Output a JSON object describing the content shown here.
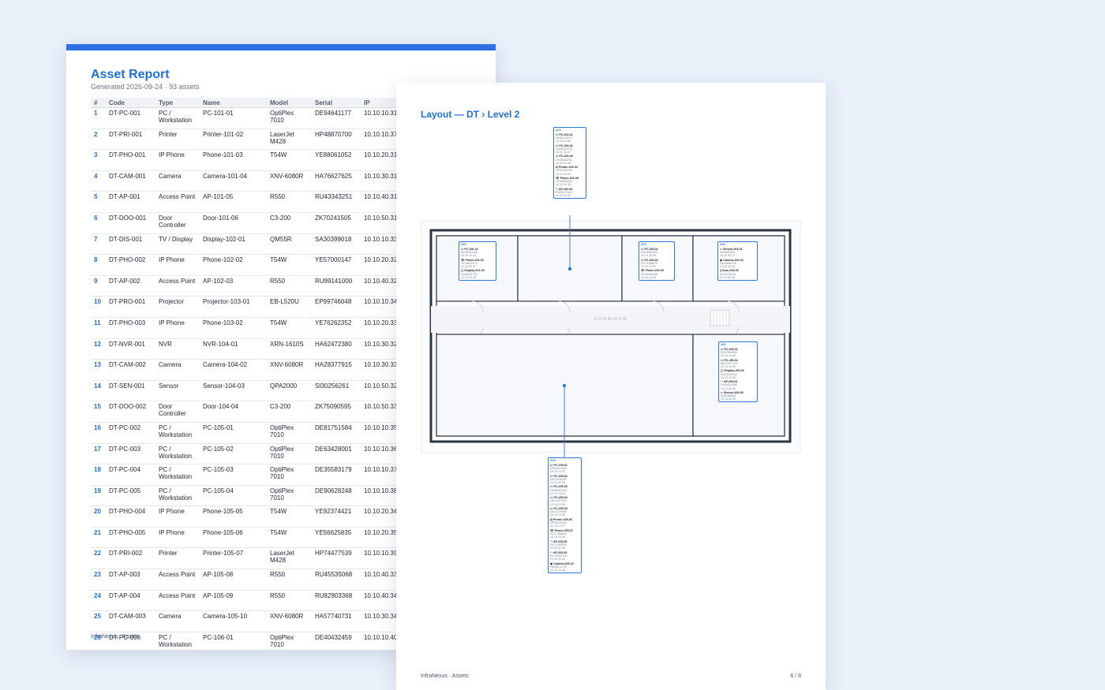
{
  "report": {
    "title": "Asset Report",
    "subtitle": "Generated 2026-09-24 · 93 assets",
    "columns": [
      "#",
      "Code",
      "Type",
      "Name",
      "Model",
      "Serial",
      "IP"
    ],
    "rows": [
      [
        "1",
        "DT-PC-001",
        "PC / Workstation",
        "PC-101-01",
        "OptiPlex 7010",
        "DE94641177",
        "10.10.10.31"
      ],
      [
        "2",
        "DT-PRI-001",
        "Printer",
        "Printer-101-02",
        "LaserJet M428",
        "HP48870700",
        "10.10.10.37"
      ],
      [
        "3",
        "DT-PHO-001",
        "IP Phone",
        "Phone-101-03",
        "T54W",
        "YE88061052",
        "10.10.20.31"
      ],
      [
        "4",
        "DT-CAM-001",
        "Camera",
        "Camera-101-04",
        "XNV-6080R",
        "HA76627625",
        "10.10.30.31"
      ],
      [
        "5",
        "DT-AP-001",
        "Access Point",
        "AP-101-05",
        "R550",
        "RU43343251",
        "10.10.40.31"
      ],
      [
        "6",
        "DT-DOO-001",
        "Door Controller",
        "Door-101-06",
        "C3-200",
        "ZK70241505",
        "10.10.50.31"
      ],
      [
        "7",
        "DT-DIS-001",
        "TV / Display",
        "Display-102-01",
        "QM55R",
        "SA30399018",
        "10.10.10.33"
      ],
      [
        "8",
        "DT-PHO-002",
        "IP Phone",
        "Phone-102-02",
        "T54W",
        "YE57000147",
        "10.10.20.32"
      ],
      [
        "9",
        "DT-AP-002",
        "Access Point",
        "AP-102-03",
        "R550",
        "RU99141000",
        "10.10.40.32"
      ],
      [
        "10",
        "DT-PRO-001",
        "Projector",
        "Projector-103-01",
        "EB-L520U",
        "EP99746048",
        "10.10.10.34"
      ],
      [
        "11",
        "DT-PHO-003",
        "IP Phone",
        "Phone-103-02",
        "T54W",
        "YE76262352",
        "10.10.20.33"
      ],
      [
        "12",
        "DT-NVR-001",
        "NVR",
        "NVR-104-01",
        "XRN-1610S",
        "HA62472380",
        "10.10.30.32"
      ],
      [
        "13",
        "DT-CAM-002",
        "Camera",
        "Camera-104-02",
        "XNV-6080R",
        "HA28377915",
        "10.10.30.33"
      ],
      [
        "14",
        "DT-SEN-001",
        "Sensor",
        "Sensor-104-03",
        "QPA2000",
        "SI30256261",
        "10.10.50.32"
      ],
      [
        "15",
        "DT-DOO-002",
        "Door Controller",
        "Door-104-04",
        "C3-200",
        "ZK75090595",
        "10.10.50.33"
      ],
      [
        "16",
        "DT-PC-002",
        "PC / Workstation",
        "PC-105-01",
        "OptiPlex 7010",
        "DE81751584",
        "10.10.10.35"
      ],
      [
        "17",
        "DT-PC-003",
        "PC / Workstation",
        "PC-105-02",
        "OptiPlex 7010",
        "DE63428001",
        "10.10.10.36"
      ],
      [
        "18",
        "DT-PC-004",
        "PC / Workstation",
        "PC-105-03",
        "OptiPlex 7010",
        "DE35583179",
        "10.10.10.37"
      ],
      [
        "19",
        "DT-PC-005",
        "PC / Workstation",
        "PC-105-04",
        "OptiPlex 7010",
        "DE90628248",
        "10.10.10.38"
      ],
      [
        "20",
        "DT-PHO-004",
        "IP Phone",
        "Phone-105-05",
        "T54W",
        "YE92374421",
        "10.10.20.34"
      ],
      [
        "21",
        "DT-PHO-005",
        "IP Phone",
        "Phone-105-06",
        "T54W",
        "YE56625835",
        "10.10.20.35"
      ],
      [
        "22",
        "DT-PRI-002",
        "Printer",
        "Printer-105-07",
        "LaserJet M428",
        "HP74477539",
        "10.10.10.39"
      ],
      [
        "23",
        "DT-AP-003",
        "Access Point",
        "AP-105-08",
        "R550",
        "RU45535068",
        "10.10.40.33"
      ],
      [
        "24",
        "DT-AP-004",
        "Access Point",
        "AP-105-09",
        "R550",
        "RU82903368",
        "10.10.40.34"
      ],
      [
        "25",
        "DT-CAM-003",
        "Camera",
        "Camera-105-10",
        "XNV-6080R",
        "HA57740731",
        "10.10.30.34"
      ],
      [
        "26",
        "DT-PC-006",
        "PC / Workstation",
        "PC-106-01",
        "OptiPlex 7010",
        "DE40432459",
        "10.10.10.40"
      ]
    ],
    "footer": "InfraNexus · Assets"
  },
  "layout": {
    "title": "Layout — DT › Level 2",
    "corridor_label": "CORRIDOR",
    "footer": "InfraNexus · Assets",
    "page_number": "6 / 8",
    "colors": {
      "accent": "#2f78d8",
      "wall": "#2c3440",
      "room_fill": "#f4f7fb"
    },
    "rooms": [
      {
        "id": "201",
        "assets": [
          {
            "icon": "monitor-icon",
            "name": "PC-201-01",
            "serial": "DE28151306",
            "ip": "10.10.10.44"
          },
          {
            "icon": "phone-icon",
            "name": "Phone-201-02",
            "serial": "YE35676474",
            "ip": "10.10.20.37"
          },
          {
            "icon": "display-icon",
            "name": "Display-201-03",
            "serial": "SA69491792",
            "ip": "10.10.10.45"
          }
        ]
      },
      {
        "id": "202",
        "assets": [
          {
            "icon": "monitor-icon",
            "name": "PC-202-01",
            "serial": "DE66224011",
            "ip": "10.10.10.46"
          },
          {
            "icon": "monitor-icon",
            "name": "PC-202-02",
            "serial": "DE62623315",
            "ip": "10.10.10.47"
          },
          {
            "icon": "monitor-icon",
            "name": "PC-202-03",
            "serial": "DE35544741",
            "ip": "10.10.10.48"
          },
          {
            "icon": "printer-icon",
            "name": "Printer-202-04",
            "serial": "HP23422040",
            "ip": "10.10.10.49"
          },
          {
            "icon": "phone-icon",
            "name": "Phone-202-05",
            "serial": "YE98636429",
            "ip": "10.10.20.38"
          },
          {
            "icon": "wifi-icon",
            "name": "AP-202-06",
            "serial": "RU26272404",
            "ip": "10.10.40.37"
          }
        ]
      },
      {
        "id": "203",
        "assets": [
          {
            "icon": "monitor-icon",
            "name": "PC-203-01",
            "serial": "DE94363365",
            "ip": "10.10.10.50"
          },
          {
            "icon": "monitor-icon",
            "name": "PC-203-02",
            "serial": "DE75156679",
            "ip": "10.10.10.51"
          },
          {
            "icon": "phone-icon",
            "name": "Phone-203-03",
            "serial": "YE46496546",
            "ip": "10.10.20.39"
          }
        ]
      },
      {
        "id": "204",
        "assets": [
          {
            "icon": "sensor-icon",
            "name": "Sensor-204-01",
            "serial": "SI64465395",
            "ip": "10.10.50.37"
          },
          {
            "icon": "camera-icon",
            "name": "Camera-204-02",
            "serial": "HA34660018",
            "ip": "10.10.30.35"
          },
          {
            "icon": "door-icon",
            "name": "Door-204-03",
            "serial": "ZK21239731",
            "ip": "10.10.50.38"
          }
        ]
      },
      {
        "id": "205",
        "assets": [
          {
            "icon": "monitor-icon",
            "name": "PC-205-01",
            "serial": "DE53522060",
            "ip": "10.10.10.52"
          },
          {
            "icon": "monitor-icon",
            "name": "PC-205-02",
            "serial": "DE21649330",
            "ip": "10.10.10.53"
          },
          {
            "icon": "monitor-icon",
            "name": "PC-205-03",
            "serial": "DE96260104",
            "ip": "10.10.10.54"
          },
          {
            "icon": "monitor-icon",
            "name": "PC-205-04",
            "serial": "DE12437810",
            "ip": "10.10.10.55"
          },
          {
            "icon": "monitor-icon",
            "name": "PC-205-05",
            "serial": "DE42375945",
            "ip": "10.10.10.56"
          },
          {
            "icon": "printer-icon",
            "name": "Printer-205-06",
            "serial": "HP33099120",
            "ip": "10.10.10.57"
          },
          {
            "icon": "phone-icon",
            "name": "Phone-205-07",
            "serial": "YE77288623",
            "ip": "10.10.20.40"
          },
          {
            "icon": "wifi-icon",
            "name": "AP-205-08",
            "serial": "RU71428309",
            "ip": "10.10.40.38"
          },
          {
            "icon": "wifi-icon",
            "name": "AP-205-09",
            "serial": "RU75604720",
            "ip": "10.10.40.39"
          },
          {
            "icon": "camera-icon",
            "name": "Camera-205-10",
            "serial": "HA56614734",
            "ip": "10.10.30.36"
          }
        ]
      },
      {
        "id": "206",
        "assets": [
          {
            "icon": "monitor-icon",
            "name": "PC-206-01",
            "serial": "DE57659683",
            "ip": "10.10.10.58"
          },
          {
            "icon": "monitor-icon",
            "name": "PC-206-02",
            "serial": "DE47427199",
            "ip": "10.10.10.59"
          },
          {
            "icon": "display-icon",
            "name": "Display-206-03",
            "serial": "SA23009252",
            "ip": "10.10.10.60"
          },
          {
            "icon": "wifi-icon",
            "name": "AP-206-04",
            "serial": "RU94502860",
            "ip": "10.10.40.40"
          },
          {
            "icon": "sensor-icon",
            "name": "Sensor-206-05",
            "serial": "SI30066604",
            "ip": "10.10.50.39"
          }
        ]
      }
    ]
  }
}
